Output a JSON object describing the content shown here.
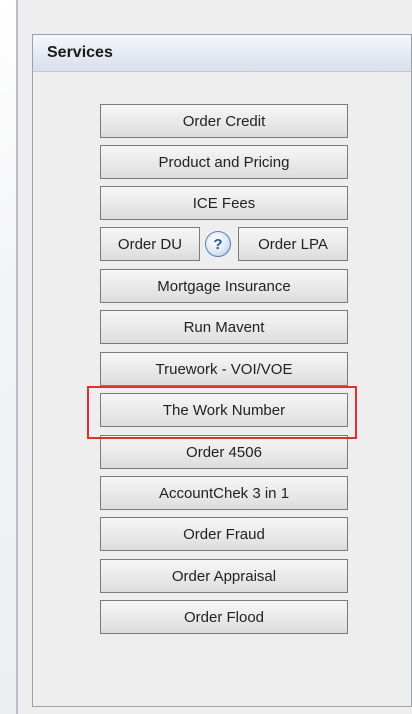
{
  "panel": {
    "title": "Services"
  },
  "buttons": {
    "order_credit": "Order Credit",
    "product_pricing": "Product and Pricing",
    "ice_fees": "ICE Fees",
    "order_du": "Order DU",
    "help": "?",
    "order_lpa": "Order LPA",
    "mortgage_insurance": "Mortgage Insurance",
    "run_mavent": "Run Mavent",
    "truework": "Truework - VOI/VOE",
    "work_number": "The Work Number",
    "order_4506": "Order 4506",
    "accountchek": "AccountChek 3 in 1",
    "order_fraud": "Order Fraud",
    "order_appraisal": "Order Appraisal",
    "order_flood": "Order Flood"
  },
  "highlight_color": "#e0312f"
}
